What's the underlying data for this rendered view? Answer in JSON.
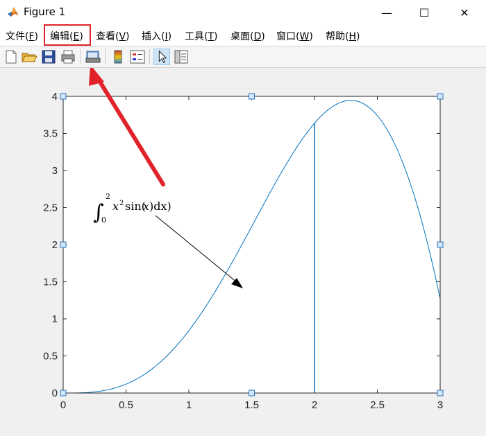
{
  "window": {
    "title": "Figure 1",
    "minimize_glyph": "—",
    "maximize_glyph": "☐",
    "close_glyph": "✕"
  },
  "menu": [
    {
      "text": "文件(",
      "acc": "F",
      "end": ")"
    },
    {
      "text": "编辑(",
      "acc": "E",
      "end": ")"
    },
    {
      "text": "查看(",
      "acc": "V",
      "end": ")"
    },
    {
      "text": "插入(",
      "acc": "I",
      "end": ")"
    },
    {
      "text": "工具(",
      "acc": "T",
      "end": ")"
    },
    {
      "text": "桌面(",
      "acc": "D",
      "end": ")"
    },
    {
      "text": "窗口(",
      "acc": "W",
      "end": ")"
    },
    {
      "text": "帮助(",
      "acc": "H",
      "end": ")"
    }
  ],
  "toolbar": {
    "icons": [
      "new-figure-icon",
      "open-file-icon",
      "save-icon",
      "print-icon",
      "print-preview-icon",
      "insert-colorbar-icon",
      "insert-legend-icon",
      "edit-plot-pointer-icon",
      "property-inspector-icon"
    ]
  },
  "colors": {
    "curve": "#0072bd",
    "highlight": "#e0232b",
    "handle_fill": "#cfe8ff",
    "handle_stroke": "#2e75b6"
  },
  "annotation": {
    "integral_sign": "∫",
    "upper_limit": "2",
    "lower_limit": "0",
    "integrand_x": "x",
    "exponent": "2",
    "sin_text": "sin(",
    "tail_text": ")dx)",
    "x_var": "x"
  },
  "chart_data": {
    "type": "line",
    "function": "x^2*sin(x)",
    "x_ticks": [
      "0",
      "0.5",
      "1",
      "1.5",
      "2",
      "2.5",
      "3"
    ],
    "y_ticks": [
      "0",
      "0.5",
      "1",
      "1.5",
      "2",
      "2.5",
      "3",
      "3.5",
      "4"
    ],
    "xlim": [
      0,
      3
    ],
    "ylim": [
      0,
      4
    ],
    "vertical_line_x": 2,
    "grid": false,
    "series": [
      {
        "x": [
          0,
          0.25,
          0.5,
          0.75,
          1.0,
          1.25,
          1.5,
          1.75,
          2.0,
          2.25,
          2.5,
          2.75,
          3.0
        ],
        "y": [
          0,
          0.015,
          0.12,
          0.383,
          0.841,
          1.482,
          2.244,
          3.014,
          3.637,
          3.93,
          3.74,
          2.892,
          1.27
        ]
      }
    ]
  }
}
